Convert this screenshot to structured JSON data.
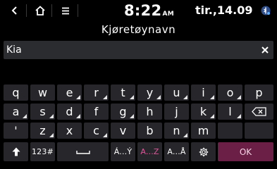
{
  "status_bar": {
    "time": "8:22",
    "ampm": "AM",
    "date": "tir.,14.09",
    "icons": [
      "back-arrow-icon",
      "home-icon",
      "menu-icon",
      "connectivity-status-icon"
    ]
  },
  "title": "Kjøretøynavn",
  "input": {
    "value": "Kia"
  },
  "keyboard": {
    "row1": [
      "q",
      "w",
      "e",
      "r",
      "t",
      "y",
      "u",
      "i",
      "o",
      "p"
    ],
    "row2": [
      "a",
      "s",
      "d",
      "f",
      "g",
      "h",
      "j",
      "k",
      "l"
    ],
    "row3": [
      "'",
      "z",
      "x",
      "c",
      "v",
      "b",
      "n",
      "m"
    ],
    "numeric_label": "123#",
    "accent_label": "Á...Ý",
    "az_label": "A...Z",
    "aa_label": "A...Å",
    "ok_label": "OK",
    "accent_color": "#e0569a"
  }
}
